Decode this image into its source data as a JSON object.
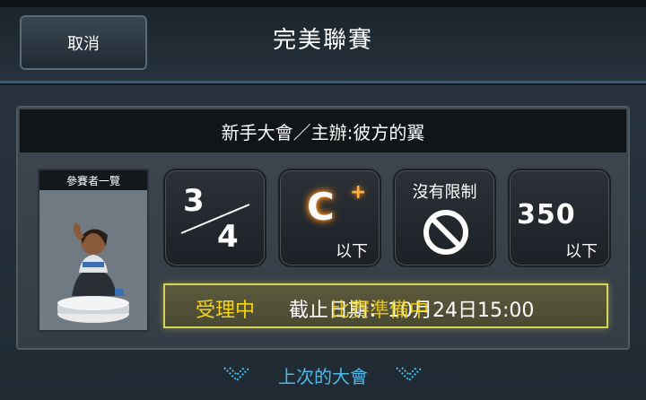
{
  "header": {
    "cancel_label": "取消",
    "title": "完美聯賽"
  },
  "panel": {
    "title": "新手大會／主辦:彼方的翼",
    "participants_label": "參賽者一覽",
    "tiles": [
      {
        "fraction_top": "3",
        "fraction_bottom": "4"
      },
      {
        "grade": "C",
        "grade_suffix": "+",
        "sub": "以下"
      },
      {
        "label": "沒有限制"
      },
      {
        "value": "350",
        "sub": "以下"
      }
    ],
    "status": {
      "label": "受理中",
      "deadline": "截止日期：10月24日15:00",
      "overlay": "比賽準備中"
    }
  },
  "footer": {
    "prev_link": "上次的大會"
  },
  "colors": {
    "accent_orange": "#ff8a1a",
    "status_yellow": "#f5d21a",
    "link_blue": "#4db8e8"
  }
}
